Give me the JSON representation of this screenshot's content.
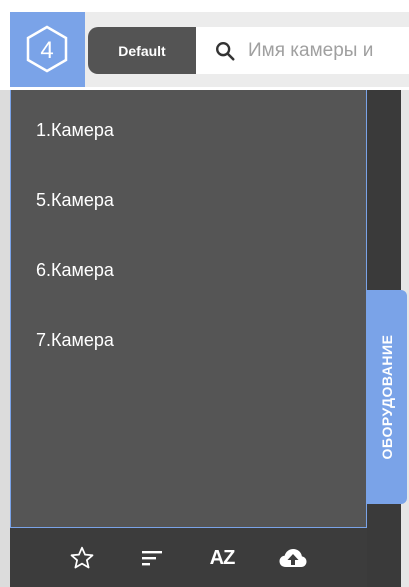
{
  "header": {
    "logo_icon": "hexagon-4-logo-icon",
    "layout_label": "Default",
    "search": {
      "placeholder": "Имя камеры и"
    }
  },
  "cameras": {
    "items": [
      {
        "label": "1.Камера"
      },
      {
        "label": "5.Камера"
      },
      {
        "label": "6.Камера"
      },
      {
        "label": "7.Камера"
      }
    ]
  },
  "side_tab": {
    "label": "ОБОРУДОВАНИЕ"
  },
  "toolbar": {
    "favorites_icon": "star-icon",
    "sort_icon": "sort-lines-icon",
    "az_label": "AZ",
    "upload_icon": "cloud-upload-icon"
  },
  "colors": {
    "accent": "#7aa3e8",
    "panel": "#555555",
    "toolbar": "#3c3c3c"
  }
}
